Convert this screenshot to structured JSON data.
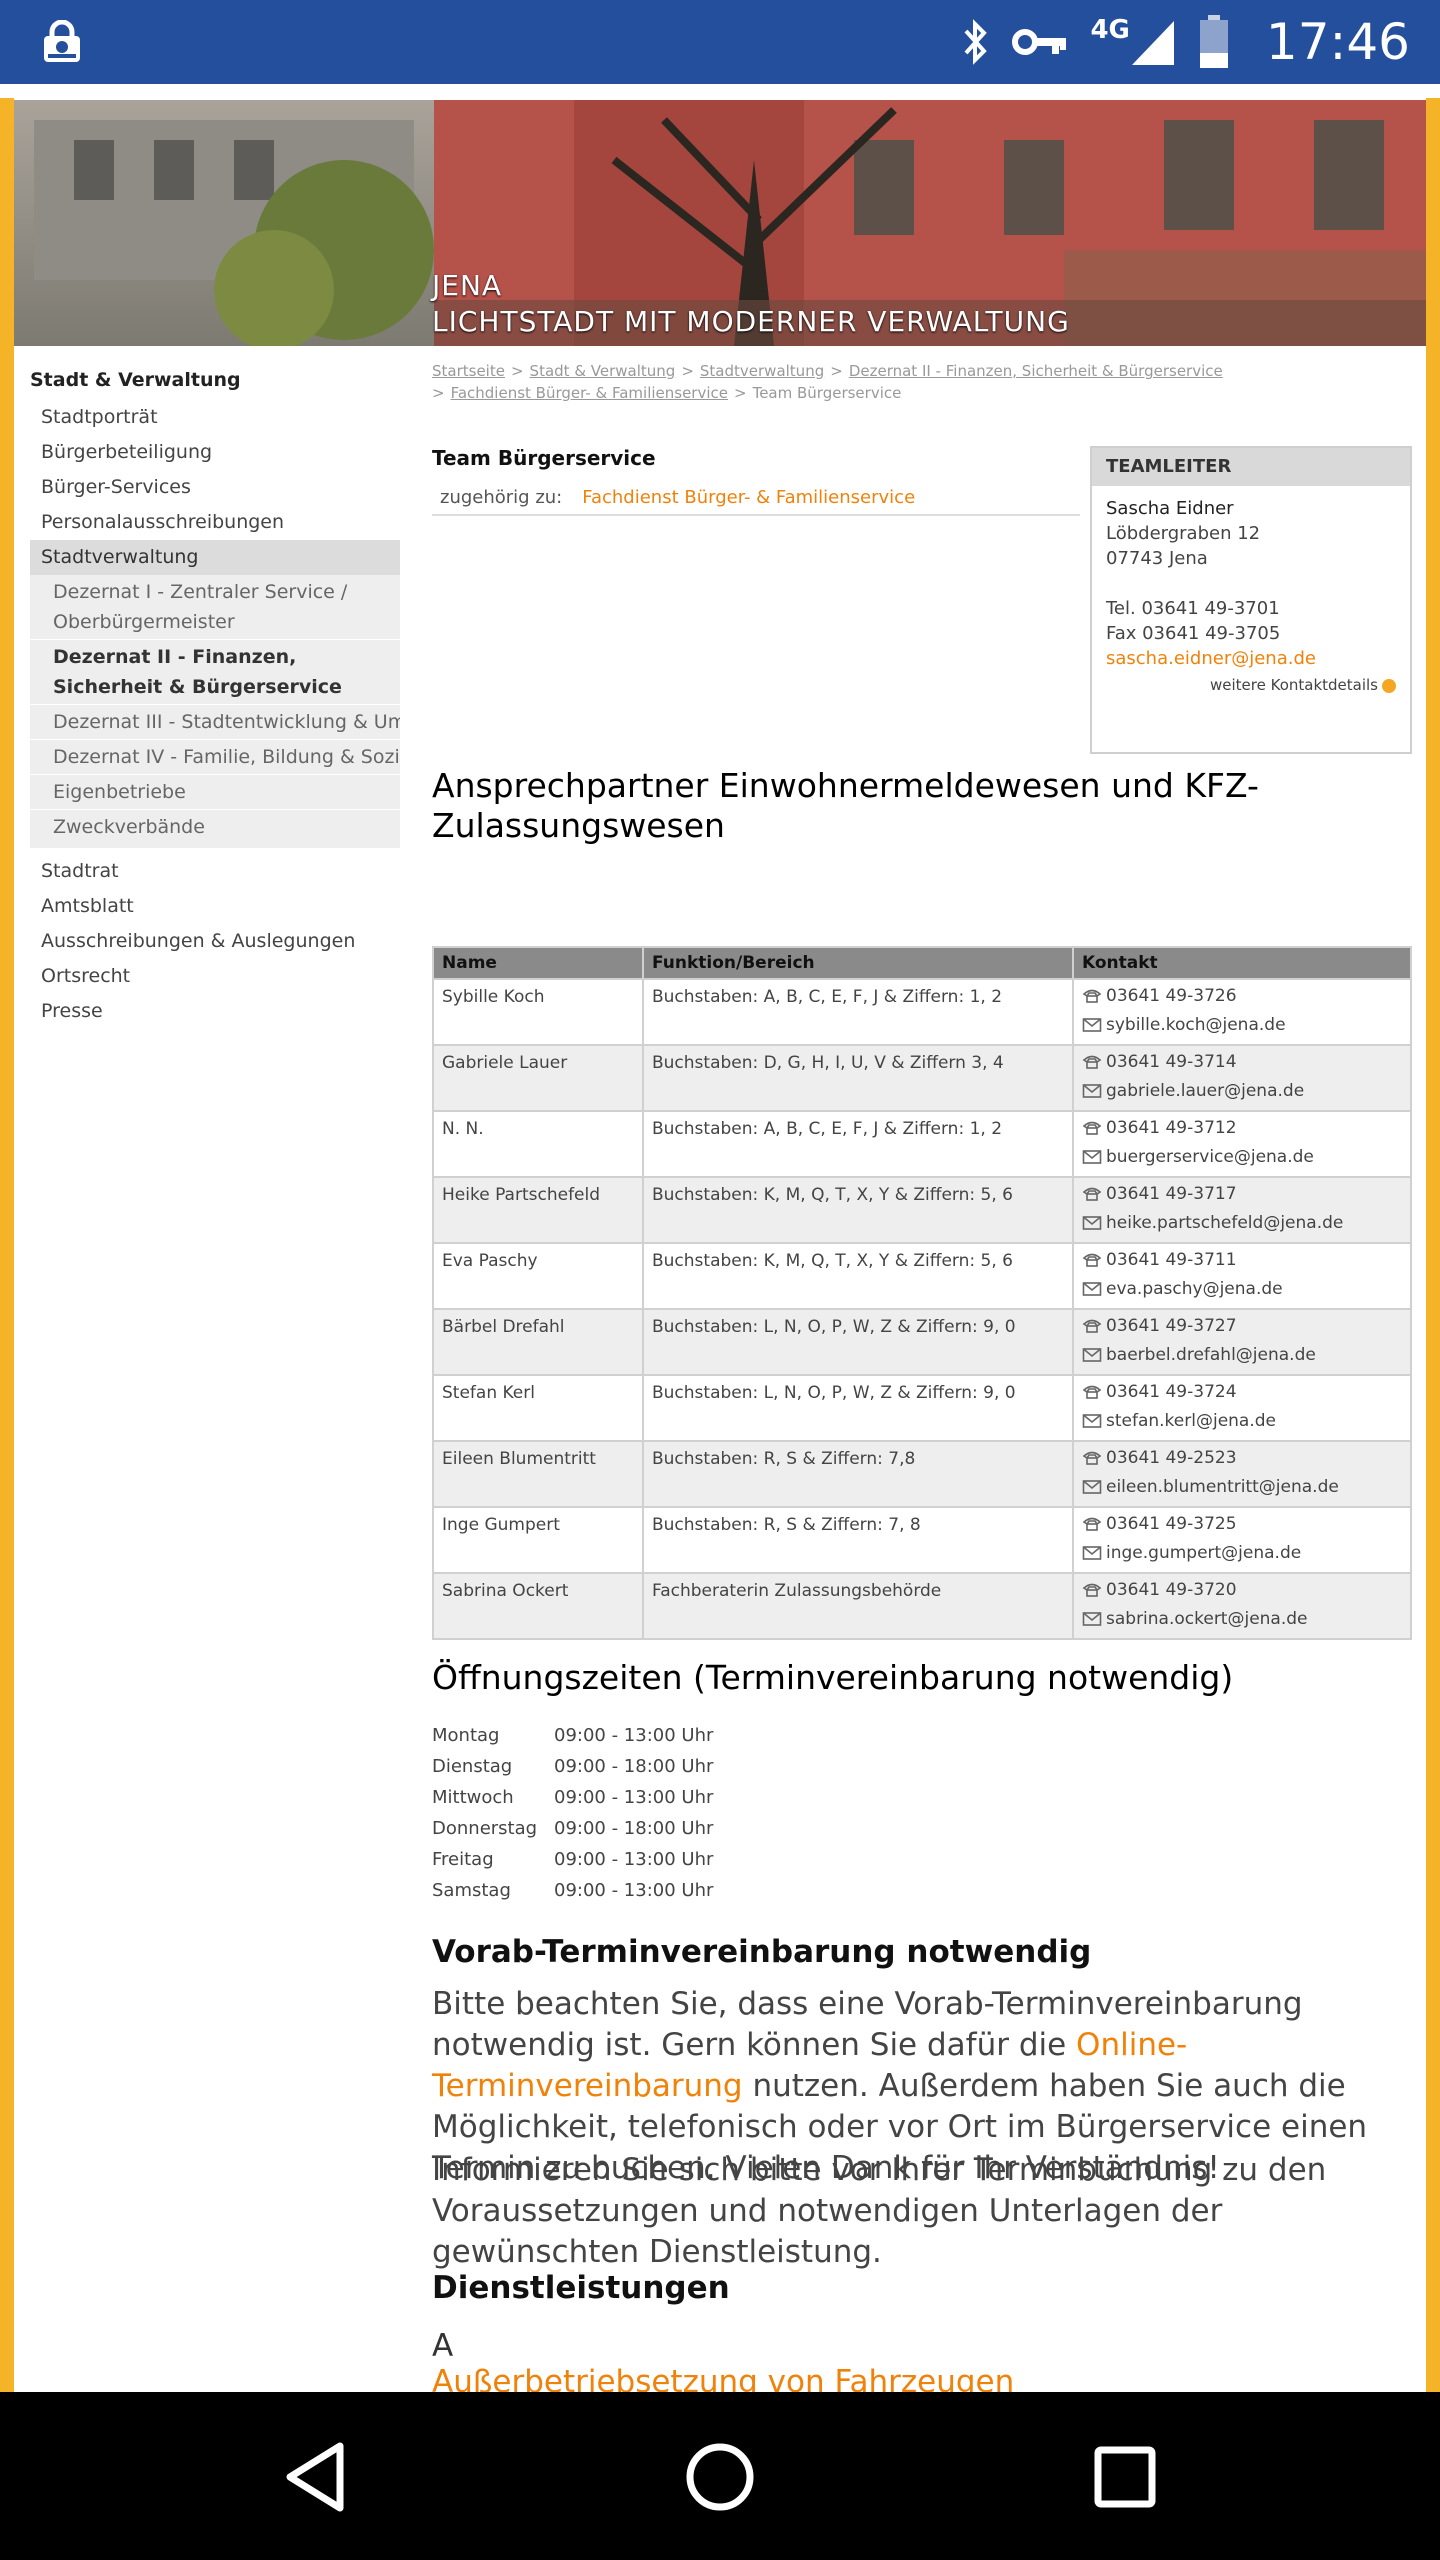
{
  "statusbar": {
    "time": "17:46",
    "network": "4G"
  },
  "banner": {
    "line1": "JENA",
    "line2": "LICHTSTADT MIT MODERNER VERWALTUNG"
  },
  "sidebar": {
    "title": "Stadt & Verwaltung",
    "items_top": [
      "Stadtporträt",
      "Bürgerbeteiligung",
      "Bürger-Services",
      "Personalausschreibungen"
    ],
    "active": "Stadtverwaltung",
    "subitems": [
      "Dezernat I - Zentraler Service / Oberbürgermeister",
      "Dezernat II - Finanzen, Sicherheit & Bürgerservice",
      "Dezernat III - Stadtentwicklung & Umwelt",
      "Dezernat IV - Familie, Bildung & Soziales",
      "Eigenbetriebe",
      "Zweckverbände"
    ],
    "items_bottom": [
      "Stadtrat",
      "Amtsblatt",
      "Ausschreibungen & Auslegungen",
      "Ortsrecht",
      "Presse"
    ]
  },
  "breadcrumb": {
    "items": [
      "Startseite",
      "Stadt & Verwaltung",
      "Stadtverwaltung",
      "Dezernat II - Finanzen, Sicherheit & Bürgerservice",
      "Fachdienst Bürger- & Familienservice"
    ],
    "current": "Team Bürgerservice"
  },
  "team": {
    "title": "Team Bürgerservice",
    "belongs_label": "zugehörig zu:",
    "belongs_link": "Fachdienst Bürger- & Familienservice"
  },
  "leader": {
    "header": "TEAMLEITER",
    "name": "Sascha  Eidner",
    "street": "Löbdergraben 12",
    "city": "07743 Jena",
    "tel": "Tel. 03641 49-3701",
    "fax": "Fax 03641 49-3705",
    "email": "sascha.eidner@jena.de",
    "more": "weitere Kontaktdetails"
  },
  "contacts": {
    "heading": "Ansprechpartner Einwohnermeldewesen und KFZ-Zulassungswesen",
    "columns": [
      "Name",
      "Funktion/Bereich",
      "Kontakt"
    ],
    "rows": [
      {
        "name": "Sybille Koch",
        "area": "Buchstaben: A, B, C, E, F, J & Ziffern: 1, 2",
        "phone": "03641 49-3726",
        "email": "sybille.koch@jena.de"
      },
      {
        "name": "Gabriele Lauer",
        "area": "Buchstaben: D, G, H, I, U, V & Ziffern 3, 4",
        "phone": "03641 49-3714",
        "email": "gabriele.lauer@jena.de"
      },
      {
        "name": "N. N.",
        "area": "Buchstaben: A, B, C, E, F, J & Ziffern: 1, 2",
        "phone": "03641 49-3712",
        "email": "buergerservice@jena.de"
      },
      {
        "name": "Heike Partschefeld",
        "area": "Buchstaben: K, M, Q, T, X, Y & Ziffern: 5, 6",
        "phone": "03641 49-3717",
        "email": "heike.partschefeld@jena.de"
      },
      {
        "name": "Eva Paschy",
        "area": "Buchstaben: K, M, Q, T, X, Y & Ziffern: 5, 6",
        "phone": "03641 49-3711",
        "email": "eva.paschy@jena.de"
      },
      {
        "name": "Bärbel Drefahl",
        "area": "Buchstaben: L, N, O, P, W, Z & Ziffern: 9, 0",
        "phone": "03641 49-3727",
        "email": "baerbel.drefahl@jena.de"
      },
      {
        "name": "Stefan Kerl",
        "area": "Buchstaben: L, N, O, P, W, Z & Ziffern: 9, 0",
        "phone": "03641 49-3724",
        "email": "stefan.kerl@jena.de"
      },
      {
        "name": "Eileen Blumentritt",
        "area": "Buchstaben: R, S & Ziffern: 7,8",
        "phone": "03641 49-2523",
        "email": "eileen.blumentritt@jena.de"
      },
      {
        "name": "Inge Gumpert",
        "area": "Buchstaben: R, S & Ziffern: 7, 8",
        "phone": "03641 49-3725",
        "email": "inge.gumpert@jena.de"
      },
      {
        "name": "Sabrina Ockert",
        "area": "Fachberaterin Zulassungsbehörde",
        "phone": "03641 49-3720",
        "email": "sabrina.ockert@jena.de"
      }
    ]
  },
  "hours": {
    "heading": "Öffnungszeiten (Terminvereinbarung notwendig)",
    "rows": [
      {
        "day": "Montag",
        "time": "09:00 - 13:00 Uhr"
      },
      {
        "day": "Dienstag",
        "time": "09:00 - 18:00 Uhr"
      },
      {
        "day": "Mittwoch",
        "time": "09:00 - 13:00 Uhr"
      },
      {
        "day": "Donnerstag",
        "time": "09:00 - 18:00 Uhr"
      },
      {
        "day": "Freitag",
        "time": "09:00 - 13:00 Uhr"
      },
      {
        "day": "Samstag",
        "time": "09:00 - 13:00 Uhr"
      }
    ]
  },
  "notice": {
    "heading": "Vorab-Terminvereinbarung notwendig",
    "p1_before": "Bitte beachten Sie, dass eine Vorab-Terminvereinbarung notwendig ist. Gern können Sie dafür die ",
    "p1_link": "Online-Terminvereinbarung",
    "p1_after": " nutzen. Außerdem haben Sie auch die Möglichkeit, telefonisch oder vor Ort im Bürgerservice einen Termin zu buchen. Vielen Dank für Ihr Verständnis!",
    "p2": "Informieren Sie sich bitte vor Ihrer Terminbuchung zu den Voraussetzungen und notwendigen Unterlagen der gewünschten Dienstleistung."
  },
  "services": {
    "heading": "Dienstleistungen",
    "letter": "A",
    "first": "Außerbetriebsetzung von Fahrzeugen"
  }
}
